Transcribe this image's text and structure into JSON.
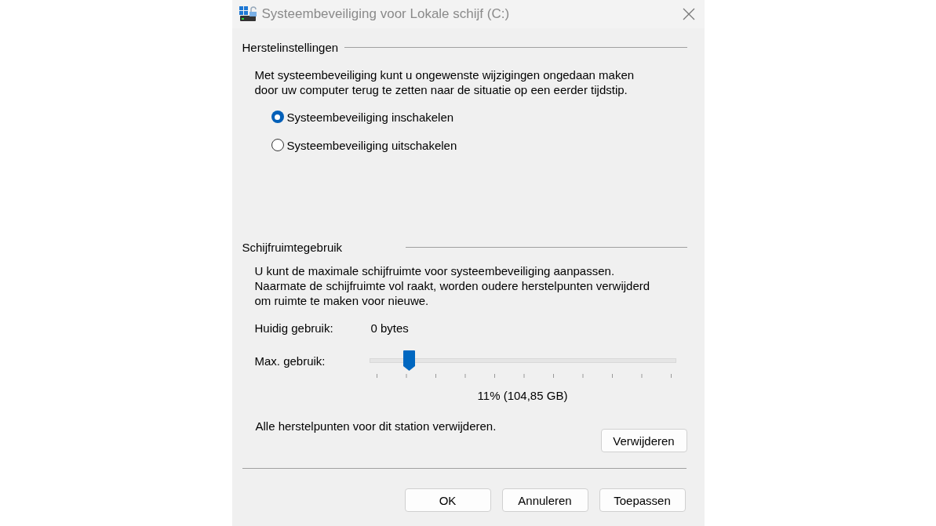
{
  "window": {
    "title": "Systeembeveiliging voor Lokale schijf (C:)"
  },
  "restore_settings": {
    "heading": "Herstelinstellingen",
    "description": "Met systeembeveiliging kunt u ongewenste wijzigingen ongedaan maken door uw computer terug te zetten naar de situatie op een eerder tijdstip.",
    "options": [
      {
        "label": "Systeembeveiliging inschakelen",
        "selected": true
      },
      {
        "label": "Systeembeveiliging uitschakelen",
        "selected": false
      }
    ]
  },
  "disk_usage": {
    "heading": "Schijfruimtegebruik",
    "description": "U kunt de maximale schijfruimte voor systeembeveiliging aanpassen. Naarmate de schijfruimte vol raakt, worden oudere herstelpunten verwijderd om ruimte te maken voor nieuwe.",
    "current_label": "Huidig gebruik:",
    "current_value": "0 bytes",
    "max_label": "Max. gebruik:",
    "max_slider": {
      "level": 0.11
    },
    "max_reading": "11% (104,85 GB)",
    "delete_text": "Alle herstelpunten voor dit station verwijderen.",
    "delete_button": "Verwijderen"
  },
  "buttons": [
    "OK",
    "Annuleren",
    "Toepassen"
  ]
}
